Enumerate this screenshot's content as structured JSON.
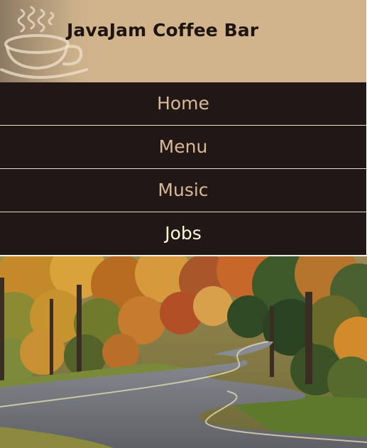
{
  "header": {
    "title": "JavaJam Coffee Bar",
    "logo_icon": "coffee-cup-icon",
    "background_color": "#d2b48c",
    "title_color": "#1e1512"
  },
  "nav": {
    "background_color": "#211716",
    "text_color": "#d8b993",
    "active_text_color": "#fff8d6",
    "divider_color": "#e9dcc6",
    "items": [
      {
        "label": "Home"
      },
      {
        "label": "Menu"
      },
      {
        "label": "Music"
      },
      {
        "label": "Jobs",
        "active": true
      }
    ]
  },
  "hero": {
    "image": "winding-road-autumn-forest"
  }
}
